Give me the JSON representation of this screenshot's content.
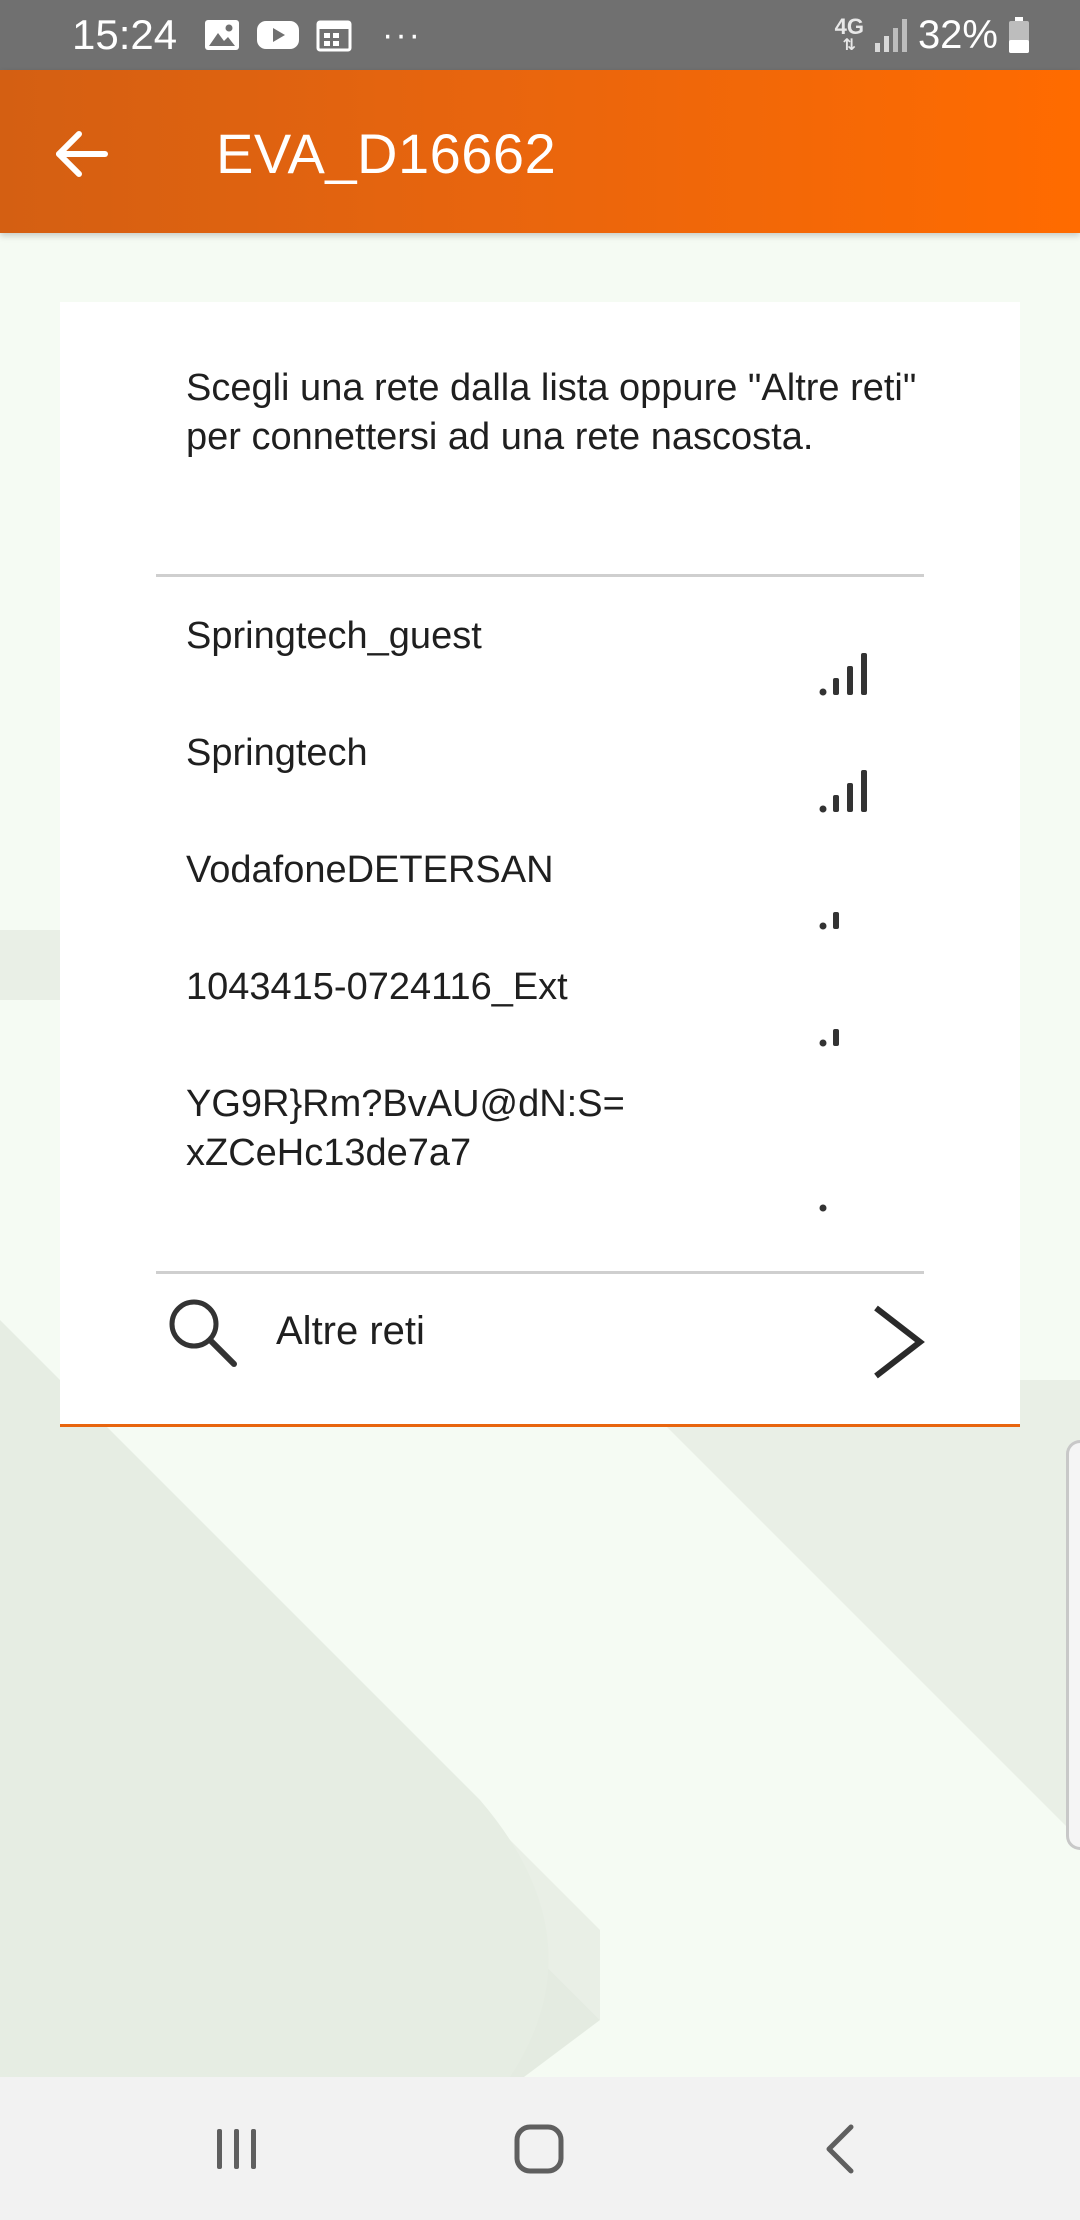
{
  "status_bar": {
    "time": "15:24",
    "left_icons": [
      "gallery-icon",
      "youtube-icon",
      "calendar-icon",
      "more-notifications-icon"
    ],
    "overflow": "···",
    "network_type": "4G",
    "battery_percent": "32%"
  },
  "app_bar": {
    "title": "EVA_D16662",
    "back_icon": "arrow-left-icon"
  },
  "card": {
    "intro": "Scegli una rete dalla lista oppure \"Altre reti\" per connettersi ad una rete nascosta.",
    "networks": [
      {
        "name": "Springtech_guest",
        "signal_bars": 4
      },
      {
        "name": "Springtech",
        "signal_bars": 4
      },
      {
        "name": "VodafoneDETERSAN",
        "signal_bars": 2
      },
      {
        "name": "1043415-0724116_Ext",
        "signal_bars": 2
      },
      {
        "name": "YG9R}Rm?BvAU@dN:S=\nxZCeHc13de7a7",
        "signal_bars": 1
      }
    ],
    "other_networks_label": "Altre reti"
  },
  "colors": {
    "accent": "#e8650e",
    "accent_light": "#ff6b00",
    "status_bar": "#707070",
    "text": "#1f1f1f",
    "background": "#f5fbf3"
  },
  "nav_bar": {
    "icons": [
      "recent-apps-icon",
      "home-icon",
      "back-icon"
    ]
  }
}
